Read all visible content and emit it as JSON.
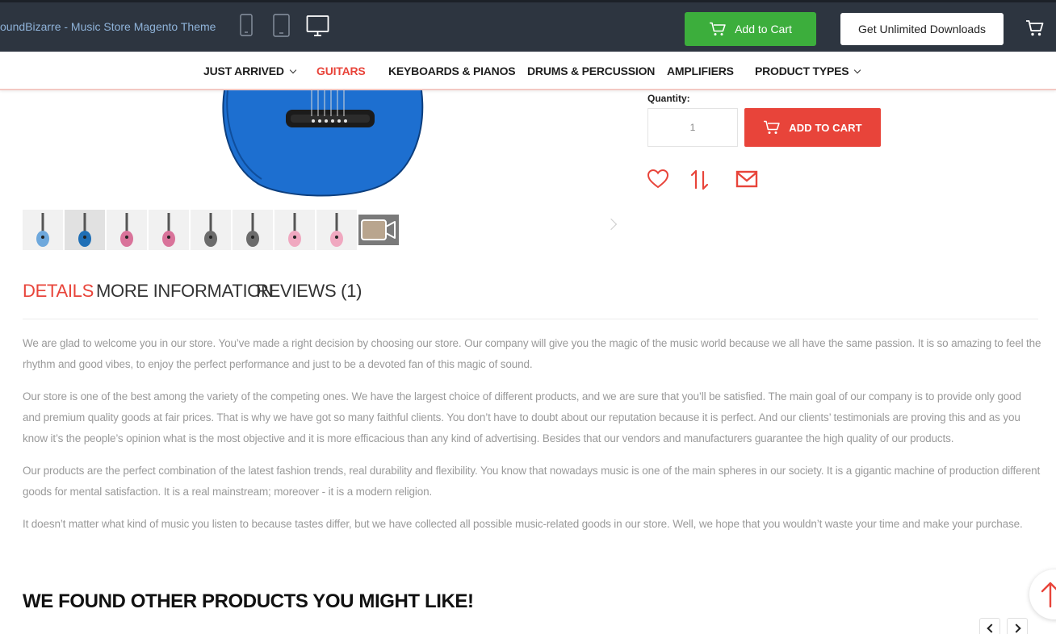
{
  "topbar": {
    "title": "oundBizarre - Music Store Magento Theme",
    "add_to_cart": "Add to Cart",
    "unlimited": "Get Unlimited Downloads"
  },
  "nav": [
    {
      "label": "JUST ARRIVED",
      "dropdown": true
    },
    {
      "label": "GUITARS",
      "active": true
    },
    {
      "label": "KEYBOARDS & PIANOS"
    },
    {
      "label": "DRUMS & PERCUSSION"
    },
    {
      "label": "AMPLIFIERS"
    },
    {
      "label": "PRODUCT TYPES",
      "dropdown": true
    }
  ],
  "product": {
    "quantity_label": "Quantity:",
    "quantity_value": "1",
    "add_to_cart": "ADD TO CART",
    "thumb_colors": [
      "#6ea8dc",
      "#1f6fb6",
      "#d9739a",
      "#d9739a",
      "#6b6b6b",
      "#6b6b6b",
      "#f0a8c0",
      "#f0a8c0"
    ]
  },
  "tabs": [
    "DETAILS",
    "MORE INFORMATION",
    "REVIEWS (1)"
  ],
  "details": [
    "We are glad to welcome you in our store. You’ve made a right decision by choosing our store. Our company will give you the magic of the music world because we all have the same passion. It is so amazing to feel the rhythm and good vibes, to enjoy the perfect performance and just to be a devoted fan of this magic of sound.",
    "Our store is one of the best among the variety of the competing ones. We have the largest choice of different products, and we are sure that you’ll be satisfied. The main goal of our company is to provide only good and premium quality goods at fair prices. That is why we have got so many faithful clients. You don’t have to doubt about our reputation because it is perfect. And our clients’ testimonials are proving this and as you know it’s the people’s opinion what is the most objective and it is more efficacious than any kind of advertising. Besides that our vendors and manufacturers guarantee the high quality of our products.",
    "Our products are the perfect combination of the latest fashion trends, real durability and flexibility. You know that nowadays music is one of the main spheres in our society. It is a gigantic machine of production different goods for mental satisfaction. It is a real mainstream; moreover - it is a modern religion.",
    "It doesn’t matter what kind of music you listen to because tastes differ, but we have collected all possible music-related goods in our store. Well, we hope that you wouldn’t waste your time and make your purchase."
  ],
  "related_title": "WE FOUND OTHER PRODUCTS YOU MIGHT LIKE!",
  "colors": {
    "accent": "#e8443a",
    "topbar": "#2d3540",
    "green": "#3cae3c"
  }
}
